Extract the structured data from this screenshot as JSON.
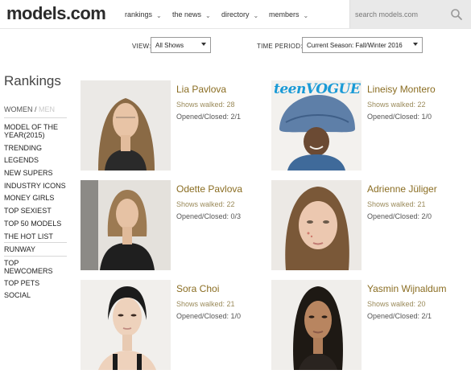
{
  "header": {
    "logo": "models.com",
    "nav": [
      {
        "label": "rankings"
      },
      {
        "label": "the news"
      },
      {
        "label": "directory"
      },
      {
        "label": "members"
      }
    ],
    "search_placeholder": "search models.com"
  },
  "filters": {
    "view_label": "VIEW:",
    "view_value": "All Shows",
    "period_label": "TIME PERIOD:",
    "period_value": "Current Season: Fall/Winter 2016"
  },
  "sidebar": {
    "title": "Rankings",
    "gender_women": "WOMEN",
    "gender_sep": " / ",
    "gender_men": "MEN",
    "items": [
      {
        "label": "MODEL OF THE YEAR(2015)"
      },
      {
        "label": "TRENDING"
      },
      {
        "label": "LEGENDS"
      },
      {
        "label": "NEW SUPERS"
      },
      {
        "label": "INDUSTRY ICONS"
      },
      {
        "label": "MONEY GIRLS"
      },
      {
        "label": "TOP SEXIEST"
      },
      {
        "label": "TOP 50 MODELS"
      },
      {
        "label": "THE HOT LIST"
      },
      {
        "label": "RUNWAY"
      },
      {
        "label": "TOP NEWCOMERS"
      },
      {
        "label": "TOP PETS"
      },
      {
        "label": "SOCIAL"
      }
    ]
  },
  "models": [
    {
      "name": "Lia Pavlova",
      "shows": "Shows walked: 28",
      "opened": "Opened/Closed: 2/1"
    },
    {
      "name": "Lineisy Montero",
      "shows": "Shows walked: 22",
      "opened": "Opened/Closed: 1/0",
      "cover_logo": "teenVOGUE"
    },
    {
      "name": "Odette Pavlova",
      "shows": "Shows walked: 22",
      "opened": "Opened/Closed: 0/3"
    },
    {
      "name": "Adrienne Jüliger",
      "shows": "Shows walked: 21",
      "opened": "Opened/Closed: 2/0"
    },
    {
      "name": "Sora Choi",
      "shows": "Shows walked: 21",
      "opened": "Opened/Closed: 1/0"
    },
    {
      "name": "Yasmin Wijnaldum",
      "shows": "Shows walked: 20",
      "opened": "Opened/Closed: 2/1"
    }
  ],
  "colors": {
    "name_gold": "#8a6d22",
    "stat_gold": "#9a8a5a",
    "search_bg": "#e9e9e9"
  }
}
